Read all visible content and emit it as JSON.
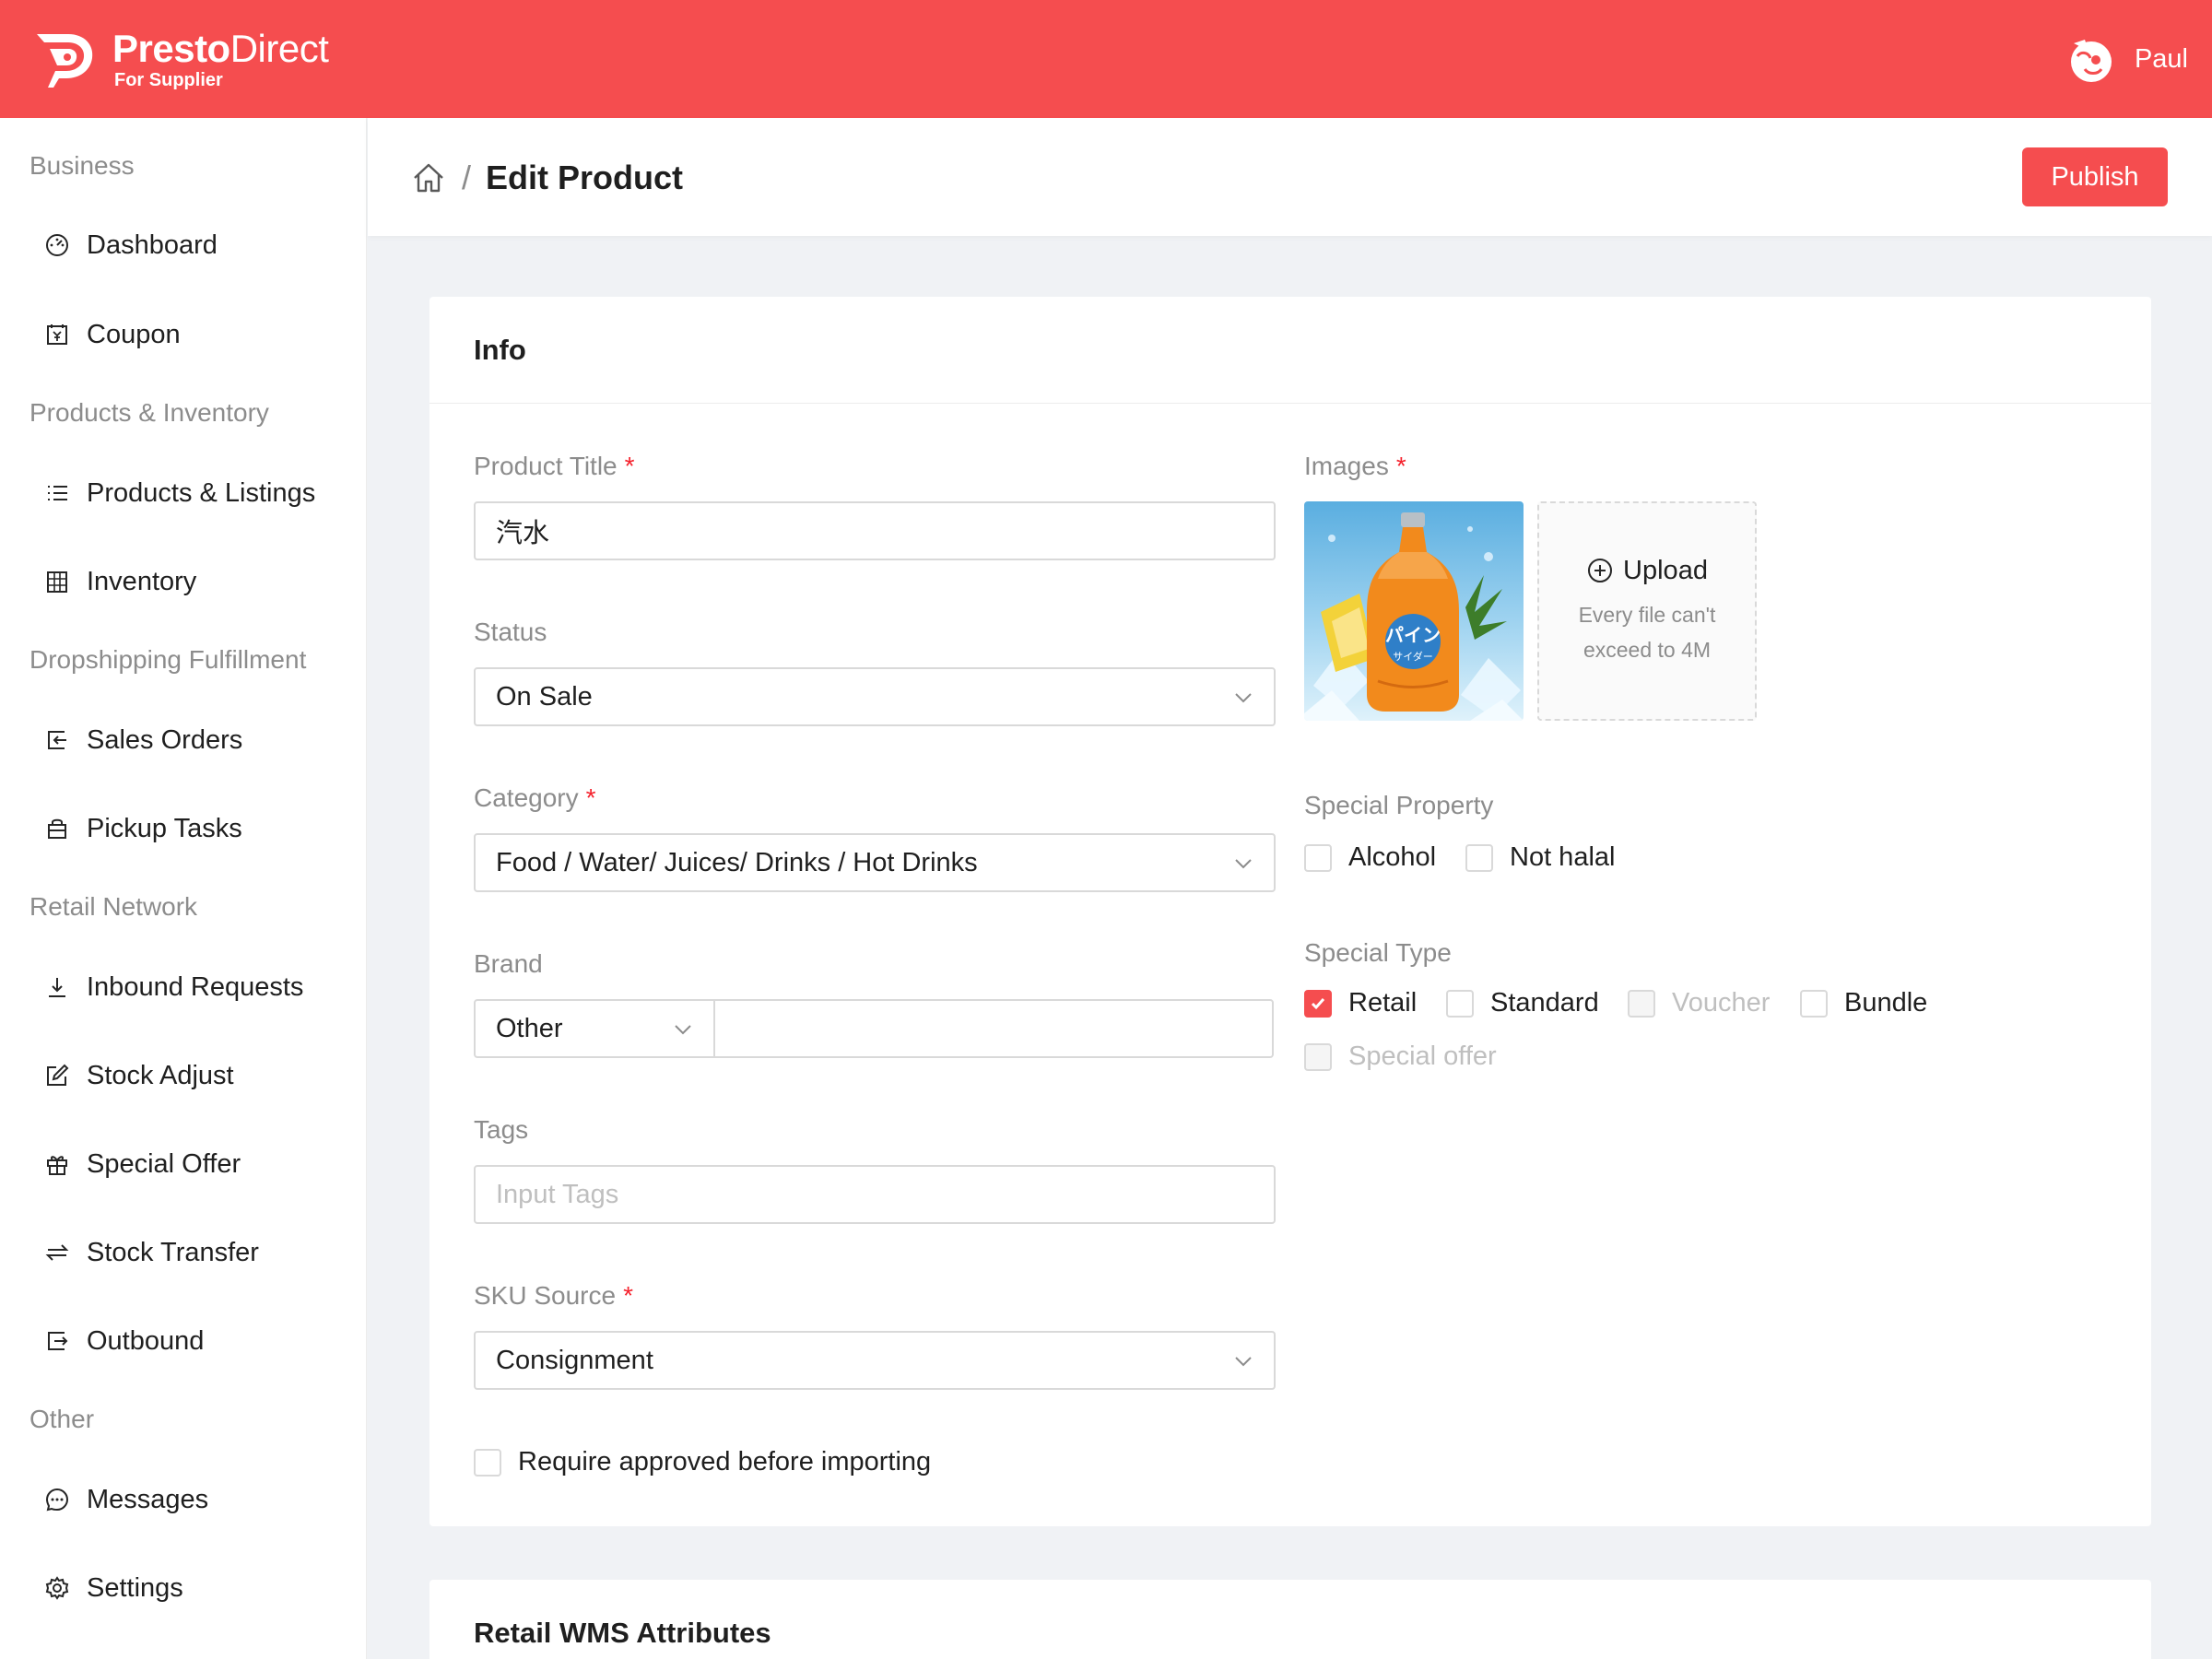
{
  "brand": {
    "name_bold": "Presto",
    "name_light": "Direct",
    "subtitle": "For Supplier"
  },
  "user": {
    "name": "Paul"
  },
  "sidebar": {
    "groups": [
      {
        "title": "Business",
        "items": [
          {
            "label": "Dashboard",
            "icon": "dashboard-icon"
          },
          {
            "label": "Coupon",
            "icon": "coupon-icon"
          }
        ]
      },
      {
        "title": "Products & Inventory",
        "items": [
          {
            "label": "Products & Listings",
            "icon": "list-icon"
          },
          {
            "label": "Inventory",
            "icon": "inventory-icon"
          }
        ]
      },
      {
        "title": "Dropshipping Fulfillment",
        "items": [
          {
            "label": "Sales Orders",
            "icon": "sales-orders-icon"
          },
          {
            "label": "Pickup Tasks",
            "icon": "pickup-icon"
          }
        ]
      },
      {
        "title": "Retail Network",
        "items": [
          {
            "label": "Inbound Requests",
            "icon": "download-icon"
          },
          {
            "label": "Stock Adjust",
            "icon": "edit-icon"
          },
          {
            "label": "Special Offer",
            "icon": "gift-icon"
          },
          {
            "label": "Stock Transfer",
            "icon": "swap-icon"
          },
          {
            "label": "Outbound",
            "icon": "export-icon"
          }
        ]
      },
      {
        "title": "Other",
        "items": [
          {
            "label": "Messages",
            "icon": "message-icon"
          },
          {
            "label": "Settings",
            "icon": "settings-icon"
          }
        ]
      }
    ]
  },
  "page": {
    "breadcrumb_sep": "/",
    "title": "Edit Product",
    "publish_label": "Publish"
  },
  "info": {
    "title": "Info",
    "product_title": {
      "label": "Product Title",
      "required": "*",
      "value": "汽水"
    },
    "status": {
      "label": "Status",
      "value": "On Sale"
    },
    "category": {
      "label": "Category",
      "required": "*",
      "value": "Food / Water/ Juices/ Drinks / Hot Drinks"
    },
    "brand": {
      "label": "Brand",
      "select_value": "Other",
      "input_value": ""
    },
    "tags": {
      "label": "Tags",
      "placeholder": "Input Tags"
    },
    "sku_source": {
      "label": "SKU Source",
      "required": "*",
      "value": "Consignment"
    },
    "require_approved": {
      "label": "Require approved before importing",
      "checked": false
    },
    "images": {
      "label": "Images",
      "required": "*",
      "upload_label": "Upload",
      "hint_line1": "Every file can't",
      "hint_line2": "exceed to 4M",
      "bottle_label": "パイン",
      "bottle_sub": "サイダー"
    },
    "special_property": {
      "label": "Special Property",
      "options": [
        {
          "label": "Alcohol",
          "checked": false
        },
        {
          "label": "Not halal",
          "checked": false
        }
      ]
    },
    "special_type": {
      "label": "Special Type",
      "options": [
        {
          "label": "Retail",
          "checked": true,
          "disabled": false
        },
        {
          "label": "Standard",
          "checked": false,
          "disabled": false
        },
        {
          "label": "Voucher",
          "checked": false,
          "disabled": true
        },
        {
          "label": "Bundle",
          "checked": false,
          "disabled": false
        },
        {
          "label": "Special offer",
          "checked": false,
          "disabled": true
        }
      ]
    }
  },
  "wms": {
    "title": "Retail WMS Attributes"
  },
  "colors": {
    "accent": "#f54d4f",
    "required": "#f5222d",
    "muted": "#8c8c8c",
    "border": "#d9d9d9"
  }
}
